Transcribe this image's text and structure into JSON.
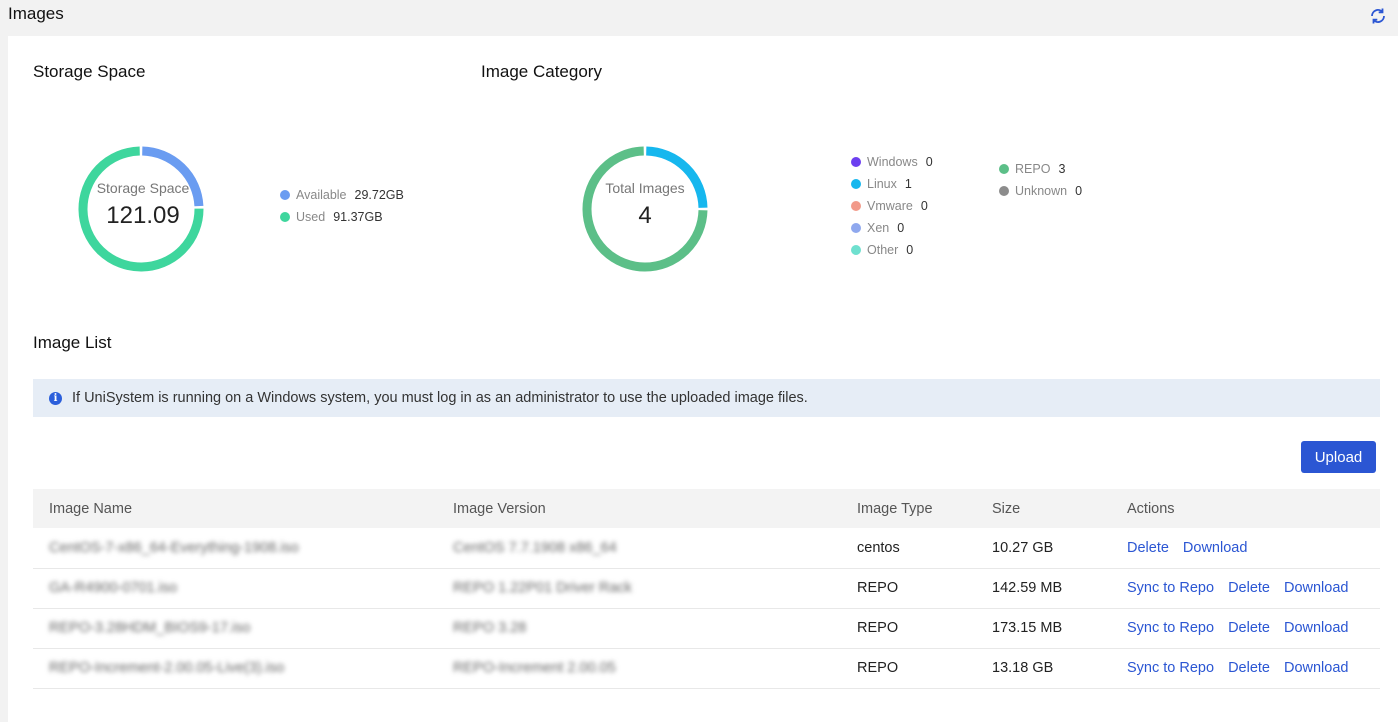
{
  "header": {
    "title": "Images",
    "refresh_icon": "refresh-icon"
  },
  "storage": {
    "title": "Storage Space",
    "label": "Storage Space",
    "value": "121.09",
    "legend": [
      {
        "label": "Available",
        "value": "29.72GB",
        "color": "#6a9cf1"
      },
      {
        "label": "Used",
        "value": "91.37GB",
        "color": "#3ed69d"
      }
    ]
  },
  "category": {
    "title": "Image Category",
    "label": "Total Images",
    "value": "4",
    "legend": [
      {
        "label": "Windows",
        "value": "0",
        "color": "#6c3ff0"
      },
      {
        "label": "Linux",
        "value": "1",
        "color": "#16b7ee"
      },
      {
        "label": "Vmware",
        "value": "0",
        "color": "#f29a8a"
      },
      {
        "label": "Xen",
        "value": "0",
        "color": "#8fa8ee"
      },
      {
        "label": "Other",
        "value": "0",
        "color": "#6fe0cf"
      },
      {
        "label": "REPO",
        "value": "3",
        "color": "#5cbf88"
      },
      {
        "label": "Unknown",
        "value": "0",
        "color": "#8c8c8c"
      }
    ]
  },
  "chart_data": [
    {
      "type": "pie",
      "title": "Storage Space",
      "categories": [
        "Available",
        "Used"
      ],
      "values": [
        29.72,
        91.37
      ],
      "units": "GB",
      "total": 121.09
    },
    {
      "type": "pie",
      "title": "Image Category",
      "categories": [
        "Windows",
        "Linux",
        "Vmware",
        "Xen",
        "Other",
        "REPO",
        "Unknown"
      ],
      "values": [
        0,
        1,
        0,
        0,
        0,
        3,
        0
      ],
      "total": 4
    }
  ],
  "list": {
    "title": "Image List",
    "notice": "If UniSystem is running on a Windows system, you must log in as an administrator to use the uploaded image files.",
    "upload_label": "Upload",
    "columns": [
      "Image Name",
      "Image Version",
      "Image Type",
      "Size",
      "Actions"
    ],
    "rows": [
      {
        "name": "CentOS-7-x86_64-Everything-1908.iso",
        "version": "CentOS 7.7.1908 x86_64",
        "type": "centos",
        "size": "10.27 GB",
        "actions": [
          "Delete",
          "Download"
        ]
      },
      {
        "name": "GA-R4900-0701.iso",
        "version": "REPO 1.22P01 Driver Rack",
        "type": "REPO",
        "size": "142.59 MB",
        "actions": [
          "Sync to Repo",
          "Delete",
          "Download"
        ]
      },
      {
        "name": "REPO-3.28HDM_BIOS9-17.iso",
        "version": "REPO 3.28",
        "type": "REPO",
        "size": "173.15 MB",
        "actions": [
          "Sync to Repo",
          "Delete",
          "Download"
        ]
      },
      {
        "name": "REPO-Increment-2.00.05-Live(3).iso",
        "version": "REPO-Increment 2.00.05",
        "type": "REPO",
        "size": "13.18 GB",
        "actions": [
          "Sync to Repo",
          "Delete",
          "Download"
        ]
      }
    ]
  }
}
